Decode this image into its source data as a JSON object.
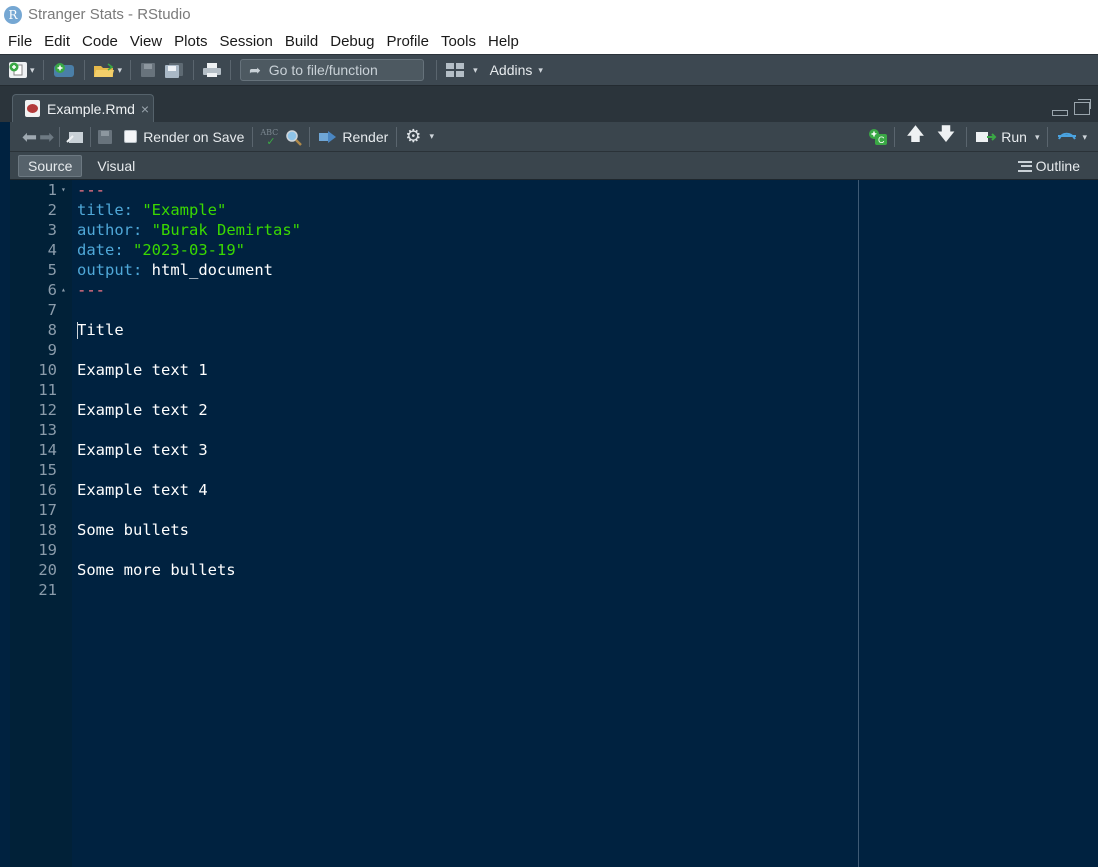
{
  "window": {
    "title": "Stranger Stats - RStudio",
    "icon_letter": "R"
  },
  "menu": [
    "File",
    "Edit",
    "Code",
    "View",
    "Plots",
    "Session",
    "Build",
    "Debug",
    "Profile",
    "Tools",
    "Help"
  ],
  "toolbar": {
    "goto_placeholder": "Go to file/function",
    "addins_label": "Addins"
  },
  "tab": {
    "name": "Example.Rmd",
    "close": "×"
  },
  "editor_toolbar": {
    "render_on_save_label": "Render on Save",
    "render_label": "Render",
    "run_label": "Run",
    "spell_label": "ABC"
  },
  "mode": {
    "source_label": "Source",
    "visual_label": "Visual",
    "outline_label": "Outline"
  },
  "code": {
    "lines": [
      {
        "n": "1",
        "fold": "▾",
        "tokens": [
          {
            "t": "---",
            "c": "dash"
          }
        ]
      },
      {
        "n": "2",
        "tokens": [
          {
            "t": "title",
            "c": "key"
          },
          {
            "t": ": ",
            "c": "key"
          },
          {
            "t": "\"Example\"",
            "c": "str"
          }
        ]
      },
      {
        "n": "3",
        "tokens": [
          {
            "t": "author",
            "c": "key"
          },
          {
            "t": ": ",
            "c": "key"
          },
          {
            "t": "\"Burak Demirtas\"",
            "c": "str"
          }
        ]
      },
      {
        "n": "4",
        "tokens": [
          {
            "t": "date",
            "c": "key"
          },
          {
            "t": ": ",
            "c": "key"
          },
          {
            "t": "\"2023-03-19\"",
            "c": "str"
          }
        ]
      },
      {
        "n": "5",
        "tokens": [
          {
            "t": "output",
            "c": "key"
          },
          {
            "t": ": ",
            "c": "key"
          },
          {
            "t": "html_document",
            "c": "plain"
          }
        ]
      },
      {
        "n": "6",
        "fold": "▴",
        "tokens": [
          {
            "t": "---",
            "c": "dash"
          }
        ]
      },
      {
        "n": "7",
        "tokens": []
      },
      {
        "n": "8",
        "tokens": [
          {
            "t": "Title",
            "c": "plain"
          }
        ],
        "cursor": true
      },
      {
        "n": "9",
        "tokens": []
      },
      {
        "n": "10",
        "tokens": [
          {
            "t": "Example text 1",
            "c": "plain"
          }
        ]
      },
      {
        "n": "11",
        "tokens": []
      },
      {
        "n": "12",
        "tokens": [
          {
            "t": "Example text 2",
            "c": "plain"
          }
        ]
      },
      {
        "n": "13",
        "tokens": []
      },
      {
        "n": "14",
        "tokens": [
          {
            "t": "Example text 3",
            "c": "plain"
          }
        ]
      },
      {
        "n": "15",
        "tokens": []
      },
      {
        "n": "16",
        "tokens": [
          {
            "t": "Example text 4",
            "c": "plain"
          }
        ]
      },
      {
        "n": "17",
        "tokens": []
      },
      {
        "n": "18",
        "tokens": [
          {
            "t": "Some bullets",
            "c": "plain"
          }
        ]
      },
      {
        "n": "19",
        "tokens": []
      },
      {
        "n": "20",
        "tokens": [
          {
            "t": "Some more bullets",
            "c": "plain"
          }
        ]
      },
      {
        "n": "21",
        "tokens": []
      }
    ]
  },
  "colors": {
    "editor_bg": "#002240",
    "key": "#4fa8d8",
    "string": "#3ad900",
    "yaml_dash": "#ff7b8a"
  }
}
